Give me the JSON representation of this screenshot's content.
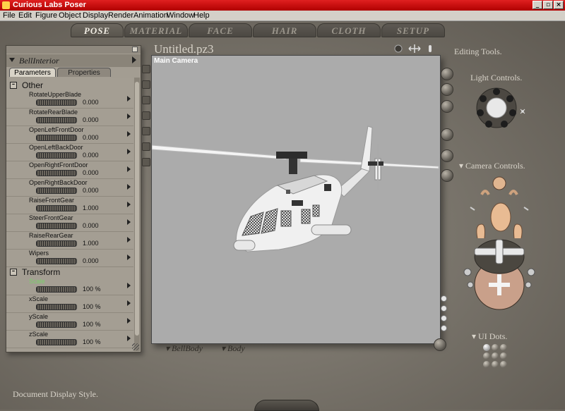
{
  "app": {
    "title": "Curious Labs Poser"
  },
  "menu": [
    "File",
    "Edit",
    "Figure",
    "Object",
    "Display",
    "Render",
    "Animation",
    "Window",
    "Help"
  ],
  "rooms": [
    "POSE",
    "MATERIAL",
    "FACE",
    "HAIR",
    "CLOTH",
    "SETUP"
  ],
  "params_panel": {
    "figure": "BellInterior",
    "tabs": [
      "Parameters",
      "Properties"
    ],
    "groups": [
      {
        "label": "Other",
        "params": [
          {
            "name": "RotateUpperBlade",
            "value": "0.000"
          },
          {
            "name": "RotateRearBlade",
            "value": "0.000"
          },
          {
            "name": "OpenLeftFrontDoor",
            "value": "0.000"
          },
          {
            "name": "OpenLeftBackDoor",
            "value": "0.000"
          },
          {
            "name": "OpenRightFrontDoor",
            "value": "0.000"
          },
          {
            "name": "OpenRightBackDoor",
            "value": "0.000"
          },
          {
            "name": "RaiseFrontGear",
            "value": "1.000"
          },
          {
            "name": "SteerFrontGear",
            "value": "0.000"
          },
          {
            "name": "RaiseRearGear",
            "value": "1.000"
          },
          {
            "name": "Wipers",
            "value": "0.000"
          }
        ]
      },
      {
        "label": "Transform",
        "params": [
          {
            "name": "Scale",
            "value": "100 %"
          },
          {
            "name": "xScale",
            "value": "100 %"
          },
          {
            "name": "yScale",
            "value": "100 %"
          },
          {
            "name": "zScale",
            "value": "100 %"
          }
        ]
      }
    ]
  },
  "document": {
    "title": "Untitled.pz3",
    "camera": "Main Camera"
  },
  "bottom_menus": {
    "figure": "BellBody",
    "actor": "Body"
  },
  "right": {
    "editing_tools": "Editing Tools.",
    "light_controls": "Light Controls.",
    "camera_controls": "Camera Controls.",
    "ui_dots": "UI Dots."
  },
  "footer": {
    "display_style": "Document Display Style."
  },
  "colors": {
    "titlebar": "#d01010",
    "workspace": "#7a756c",
    "viewport_bg": "#ababab",
    "highlight_param": "#79d06a"
  }
}
